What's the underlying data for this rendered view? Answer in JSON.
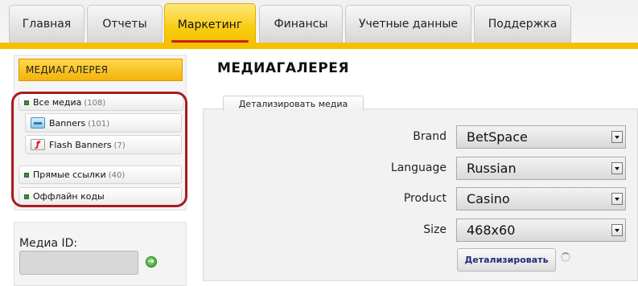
{
  "nav": {
    "tabs": [
      {
        "label": "Главная",
        "active": false
      },
      {
        "label": "Отчеты",
        "active": false
      },
      {
        "label": "Маркетинг",
        "active": true
      },
      {
        "label": "Финансы",
        "active": false
      },
      {
        "label": "Учетные данные",
        "active": false
      },
      {
        "label": "Поддержка",
        "active": false
      }
    ]
  },
  "sidebar": {
    "title": "МЕДИАГАЛЕРЕЯ",
    "items": [
      {
        "label": "Все медиа",
        "count": "(108)"
      },
      {
        "label": "Banners",
        "count": "(101)"
      },
      {
        "label": "Flash Banners",
        "count": "(7)"
      },
      {
        "label": "Прямые ссылки",
        "count": "(40)"
      },
      {
        "label": "Оффлайн коды",
        "count": ""
      }
    ],
    "media_id_label": "Медиа ID:",
    "media_id_value": ""
  },
  "main": {
    "title": "МЕДИАГАЛЕРЕЯ",
    "panel_tab": "Детализировать медиа",
    "fields": [
      {
        "label": "Brand",
        "value": "BetSpace"
      },
      {
        "label": "Language",
        "value": "Russian"
      },
      {
        "label": "Product",
        "value": "Casino"
      },
      {
        "label": "Size",
        "value": "468x60"
      }
    ],
    "submit_label": "Детализировать"
  },
  "colors": {
    "accent": "#f5c000",
    "highlight_ring": "#a91c1c",
    "button_text": "#1d2e7a"
  }
}
